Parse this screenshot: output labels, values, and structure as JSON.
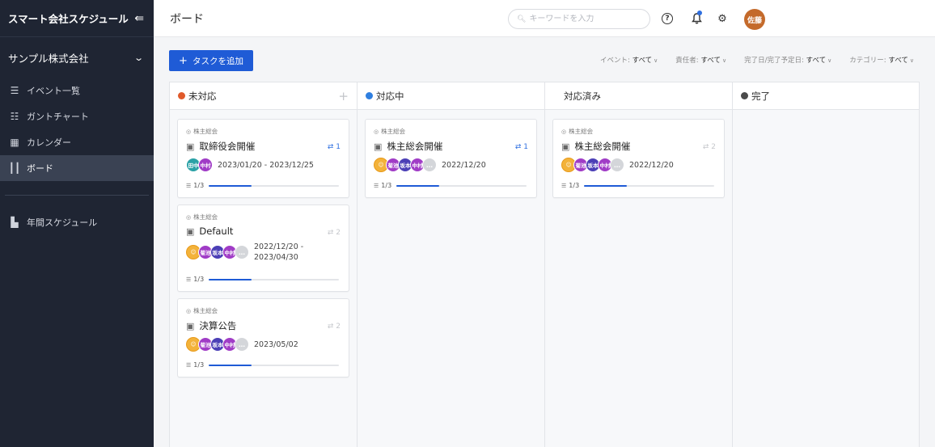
{
  "app": {
    "title": "スマート会社スケジュール",
    "collapse_icon": "collapse-left-icon"
  },
  "company": {
    "name": "サンプル株式会社"
  },
  "nav": [
    {
      "label": "イベント一覧",
      "icon": "list-icon",
      "glyph": "☰",
      "active": false
    },
    {
      "label": "ガントチャート",
      "icon": "gantt-icon",
      "glyph": "☷",
      "active": false
    },
    {
      "label": "カレンダー",
      "icon": "calendar-icon",
      "glyph": "▦",
      "active": false
    },
    {
      "label": "ボード",
      "icon": "board-icon",
      "glyph": "┃┃",
      "active": true
    },
    {
      "label": "年間スケジュール",
      "icon": "building-icon",
      "glyph": "▙",
      "active": false
    }
  ],
  "header": {
    "title": "ボード",
    "search_placeholder": "キーワードを入力",
    "user_initials": "佐藤"
  },
  "toolbar": {
    "add_label": "タスクを追加",
    "filters": [
      {
        "label": "イベント:",
        "value": "すべて"
      },
      {
        "label": "責任者:",
        "value": "すべて"
      },
      {
        "label": "完了日/完了予定日:",
        "value": "すべて"
      },
      {
        "label": "カテゴリー:",
        "value": "すべて"
      }
    ]
  },
  "columns": [
    {
      "title": "未対応",
      "dot_color": "#e05a2b",
      "show_add": true,
      "cards": [
        {
          "category": "株主総会",
          "title": "取締役会開催",
          "subtasks": "1",
          "sub_active": true,
          "avatars": [
            {
              "label": "田中",
              "color": "#2aa1a6"
            },
            {
              "label": "中村",
              "color": "#a03cc6"
            }
          ],
          "date": "2023/01/20 - 2023/12/25",
          "progress": "1/3",
          "progress_value": 0.33,
          "tall": false
        },
        {
          "category": "株主総会",
          "title": "Default",
          "subtasks": "2",
          "sub_active": false,
          "avatars": [
            {
              "label": "",
              "color": "photo"
            },
            {
              "label": "菊池",
              "color": "#a03cc6"
            },
            {
              "label": "坂本",
              "color": "#4b3fb6"
            },
            {
              "label": "中村",
              "color": "#a03cc6"
            },
            {
              "label": "…",
              "color": "more"
            }
          ],
          "date": "2022/12/20 - 2023/04/30",
          "progress": "1/3",
          "progress_value": 0.33,
          "tall": true
        },
        {
          "category": "株主総会",
          "title": "決算公告",
          "subtasks": "2",
          "sub_active": false,
          "avatars": [
            {
              "label": "",
              "color": "photo"
            },
            {
              "label": "菊池",
              "color": "#a03cc6"
            },
            {
              "label": "坂本",
              "color": "#4b3fb6"
            },
            {
              "label": "中村",
              "color": "#a03cc6"
            },
            {
              "label": "…",
              "color": "more"
            }
          ],
          "date": "2023/05/02",
          "progress": "1/3",
          "progress_value": 0.33,
          "tall": false
        }
      ]
    },
    {
      "title": "対応中",
      "dot_color": "#2f7fe0",
      "show_add": false,
      "cards": [
        {
          "category": "株主総会",
          "title": "株主総会開催",
          "subtasks": "1",
          "sub_active": true,
          "avatars": [
            {
              "label": "",
              "color": "photo"
            },
            {
              "label": "菊池",
              "color": "#a03cc6"
            },
            {
              "label": "坂本",
              "color": "#4b3fb6"
            },
            {
              "label": "中村",
              "color": "#a03cc6"
            },
            {
              "label": "…",
              "color": "more"
            }
          ],
          "date": "2022/12/20",
          "progress": "1/3",
          "progress_value": 0.33,
          "tall": false
        }
      ]
    },
    {
      "title": "対応済み",
      "dot_color": "",
      "show_add": false,
      "cards": [
        {
          "category": "株主総会",
          "title": "株主総会開催",
          "subtasks": "2",
          "sub_active": false,
          "avatars": [
            {
              "label": "",
              "color": "photo"
            },
            {
              "label": "菊池",
              "color": "#a03cc6"
            },
            {
              "label": "坂本",
              "color": "#4b3fb6"
            },
            {
              "label": "中村",
              "color": "#a03cc6"
            },
            {
              "label": "…",
              "color": "more"
            }
          ],
          "date": "2022/12/20",
          "progress": "1/3",
          "progress_value": 0.33,
          "tall": false
        }
      ]
    },
    {
      "title": "完了",
      "dot_color": "#4a4a4a",
      "show_add": false,
      "cards": []
    }
  ]
}
